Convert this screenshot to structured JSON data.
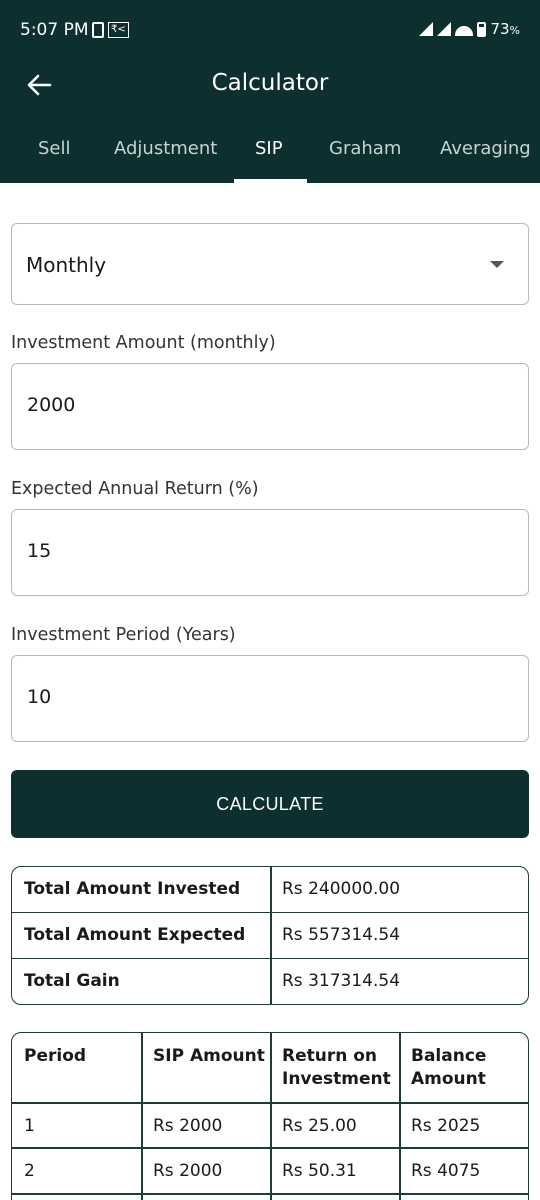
{
  "status_bar": {
    "time": "5:07 PM",
    "battery": "73",
    "battery_suffix": "%"
  },
  "app_bar": {
    "title": "Calculator",
    "back_icon": "arrow-left-icon"
  },
  "tabs": [
    {
      "label": "Sell",
      "active": false
    },
    {
      "label": "Adjustment",
      "active": false
    },
    {
      "label": "SIP",
      "active": true
    },
    {
      "label": "Graham",
      "active": false
    },
    {
      "label": "Averaging",
      "active": false
    }
  ],
  "frequency": {
    "selected": "Monthly"
  },
  "form": {
    "amount_label": "Investment Amount (monthly)",
    "amount_value": "2000",
    "return_label": "Expected Annual Return (%)",
    "return_value": "15",
    "period_label": "Investment Period (Years)",
    "period_value": "10"
  },
  "calculate_label": "CALCULATE",
  "summary": [
    {
      "label": "Total Amount Invested",
      "value": "Rs 240000.00"
    },
    {
      "label": "Total Amount Expected",
      "value": "Rs 557314.54"
    },
    {
      "label": "Total Gain",
      "value": "Rs 317314.54"
    }
  ],
  "period_table": {
    "headers": [
      "Period",
      "SIP Amount",
      "Return on Investment",
      "Balance Amount"
    ],
    "header_lines": [
      [
        "Period"
      ],
      [
        "SIP Amount"
      ],
      [
        "Return on",
        "Investment"
      ],
      [
        "Balance",
        "Amount"
      ]
    ],
    "rows": [
      [
        "1",
        "Rs 2000",
        "Rs 25.00",
        "Rs 2025"
      ],
      [
        "2",
        "Rs 2000",
        "Rs 50.31",
        "Rs 4075"
      ]
    ]
  },
  "colors": {
    "primary": "#0d2f2f",
    "border": "#1f3b3b"
  }
}
